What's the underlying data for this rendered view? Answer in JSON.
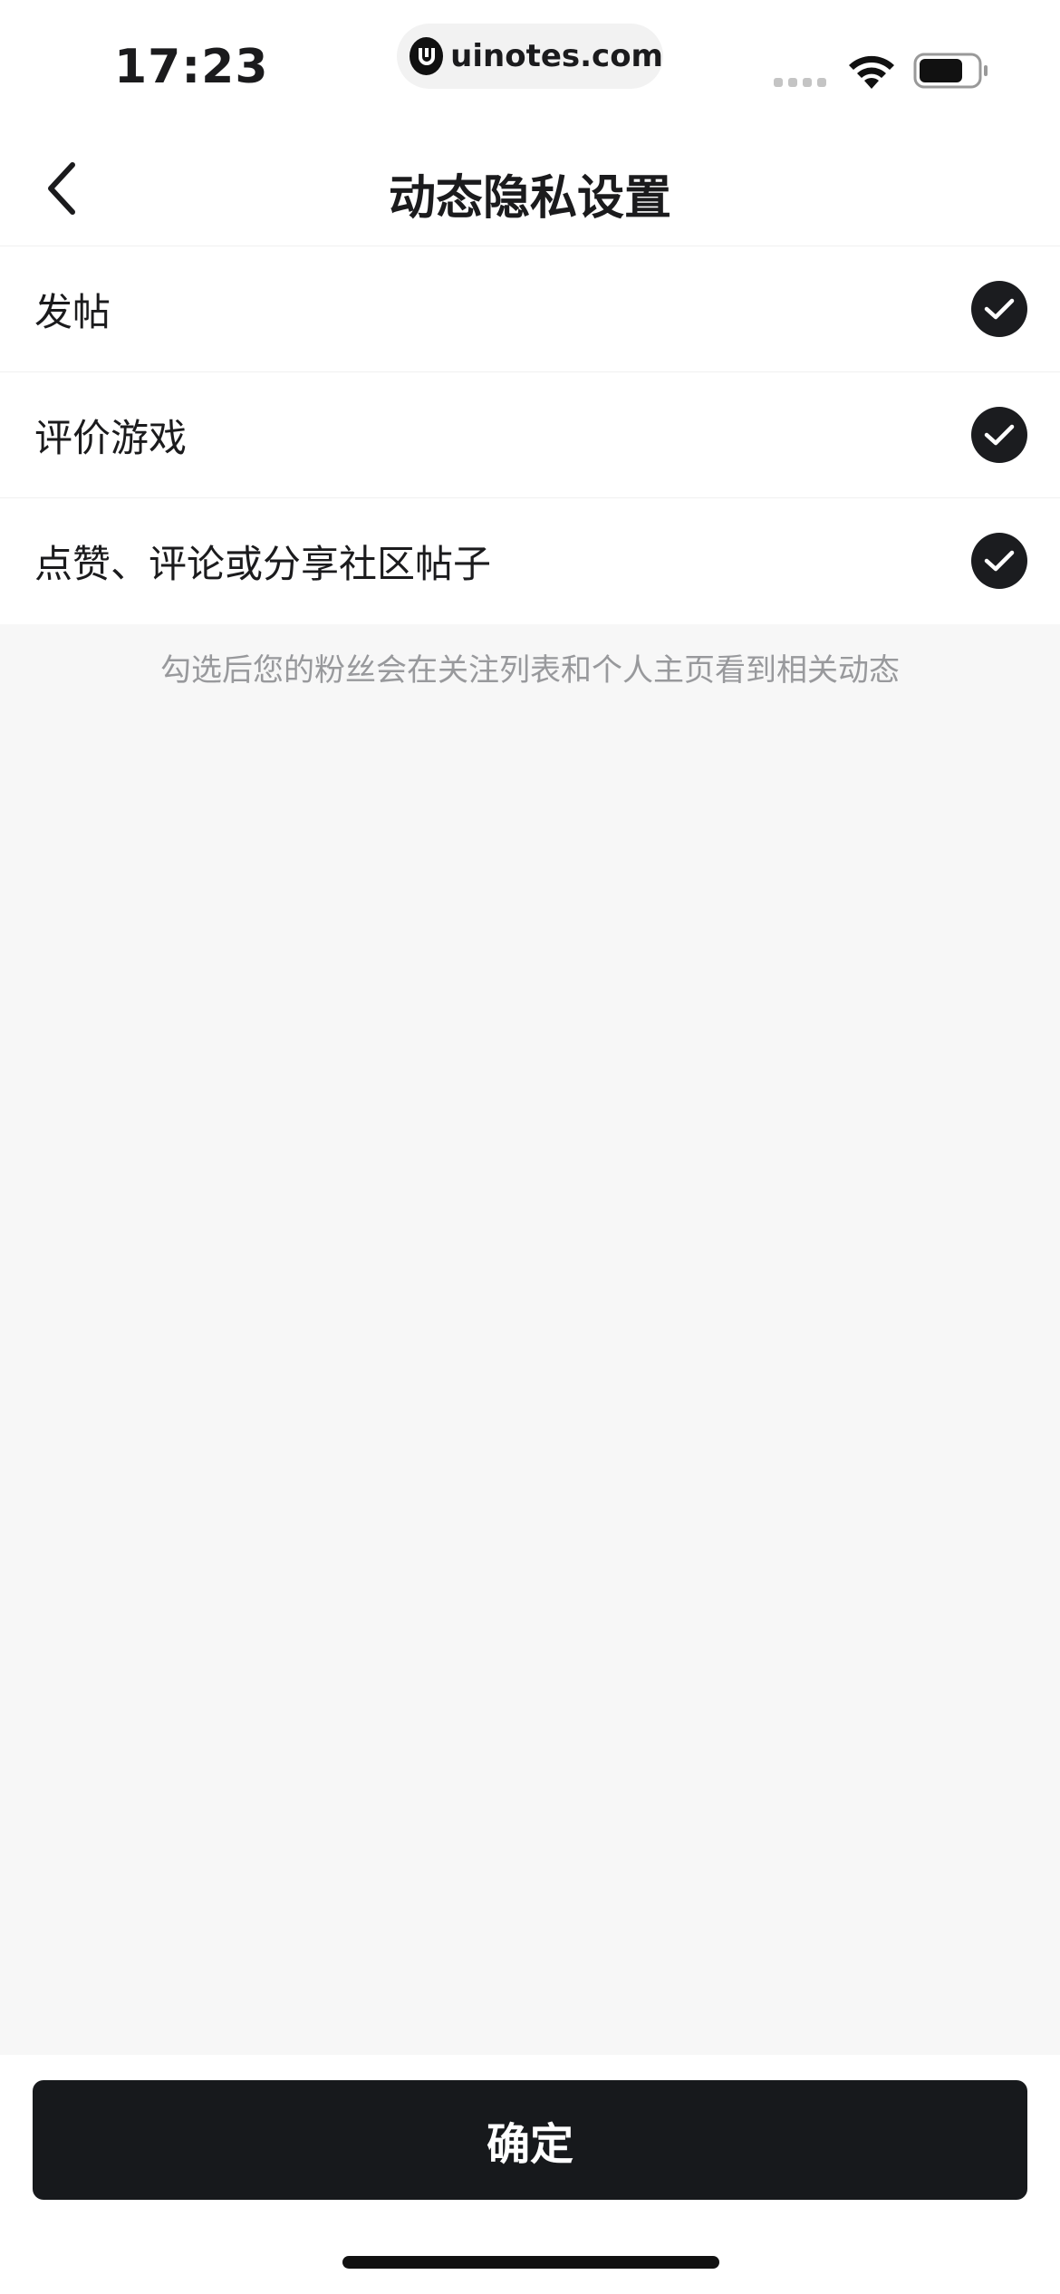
{
  "status_bar": {
    "time": "17:23",
    "url": "uinotes.com",
    "battery_level": 0.75
  },
  "nav": {
    "title": "动态隐私设置",
    "back_icon": "chevron-left-icon"
  },
  "options": [
    {
      "label": "发帖",
      "checked": true
    },
    {
      "label": "评价游戏",
      "checked": true
    },
    {
      "label": "点赞、评论或分享社区帖子",
      "checked": true
    }
  ],
  "hint": "勾选后您的粉丝会在关注列表和个人主页看到相关动态",
  "footer": {
    "confirm_label": "确定"
  },
  "colors": {
    "primary": "#17191c",
    "background": "#f7f7f7",
    "hint_text": "#98999c"
  }
}
